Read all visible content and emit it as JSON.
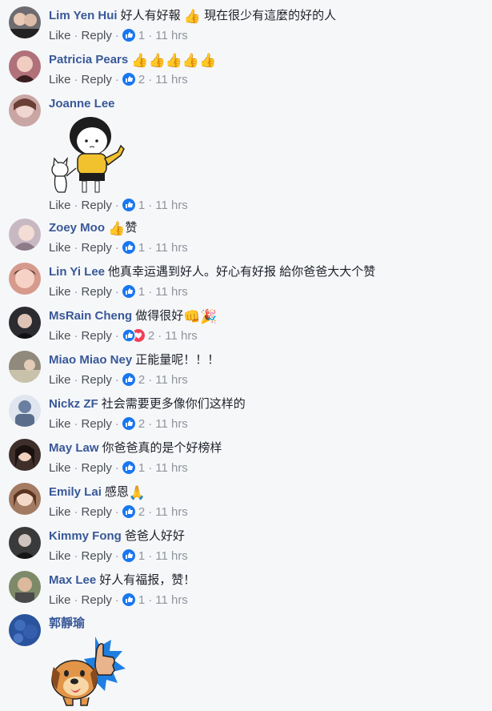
{
  "comments": [
    {
      "author": "Lim Yen Hui",
      "text": "好人有好報",
      "emoji1": "👍",
      "text2": "現在很少有這麼的好的人",
      "like": "Like",
      "reply": "Reply",
      "reactions": "1",
      "time": "11 hrs",
      "avatar": "#6d6b70"
    },
    {
      "author": "Patricia Pears",
      "emojis": "👍👍👍👍👍",
      "like": "Like",
      "reply": "Reply",
      "reactions": "2",
      "time": "11 hrs",
      "avatar": "#b0717a"
    },
    {
      "author": "Joanne Lee",
      "like": "Like",
      "reply": "Reply",
      "reactions": "1",
      "time": "11 hrs",
      "avatar": "#c9a6a3"
    },
    {
      "author": "Zoey Moo",
      "emoji1": "👍",
      "text": "赞",
      "like": "Like",
      "reply": "Reply",
      "reactions": "1",
      "time": "11 hrs",
      "avatar": "#c7b8c2"
    },
    {
      "author": "Lin Yi Lee",
      "text": "他真幸运遇到好人。好心有好报 給你爸爸大大个赞",
      "like": "Like",
      "reply": "Reply",
      "reactions": "1",
      "time": "11 hrs",
      "avatar": "#d69a8c"
    },
    {
      "author": "MsRain Cheng",
      "text": "做得很好",
      "emoji1": "👊",
      "emoji2": "🎉",
      "like": "Like",
      "reply": "Reply",
      "reactions": "2",
      "time": "11 hrs",
      "avatar": "#2b2b30"
    },
    {
      "author": "Miao Miao Ney",
      "text": "正能量呢！！！",
      "like": "Like",
      "reply": "Reply",
      "reactions": "2",
      "time": "11 hrs",
      "avatar": "#8f8a7b"
    },
    {
      "author": "Nickz ZF",
      "text": "社会需要更多像你们这样的",
      "like": "Like",
      "reply": "Reply",
      "reactions": "2",
      "time": "11 hrs",
      "avatar": "#5a6e8c"
    },
    {
      "author": "May Law",
      "text": "你爸爸真的是个好榜样",
      "like": "Like",
      "reply": "Reply",
      "reactions": "1",
      "time": "11 hrs",
      "avatar": "#3e2f2a"
    },
    {
      "author": "Emily Lai",
      "text": "感恩",
      "emoji1": "🙏",
      "like": "Like",
      "reply": "Reply",
      "reactions": "2",
      "time": "11 hrs",
      "avatar": "#a37a62"
    },
    {
      "author": "Kimmy Fong",
      "text": "爸爸人好好",
      "like": "Like",
      "reply": "Reply",
      "reactions": "1",
      "time": "11 hrs",
      "avatar": "#3a3a3a"
    },
    {
      "author": "Max Lee",
      "text": "好人有福报，赞！",
      "like": "Like",
      "reply": "Reply",
      "reactions": "1",
      "time": "11 hrs",
      "avatar": "#7d8a6a"
    },
    {
      "author": "郭靜瑜",
      "avatar": "#2d5aa8"
    }
  ],
  "colors": {
    "author": "#385898",
    "like_blue": "#1877f2",
    "love_red": "#f33e58",
    "muted": "#90949c",
    "bg": "#f6f7f9"
  }
}
